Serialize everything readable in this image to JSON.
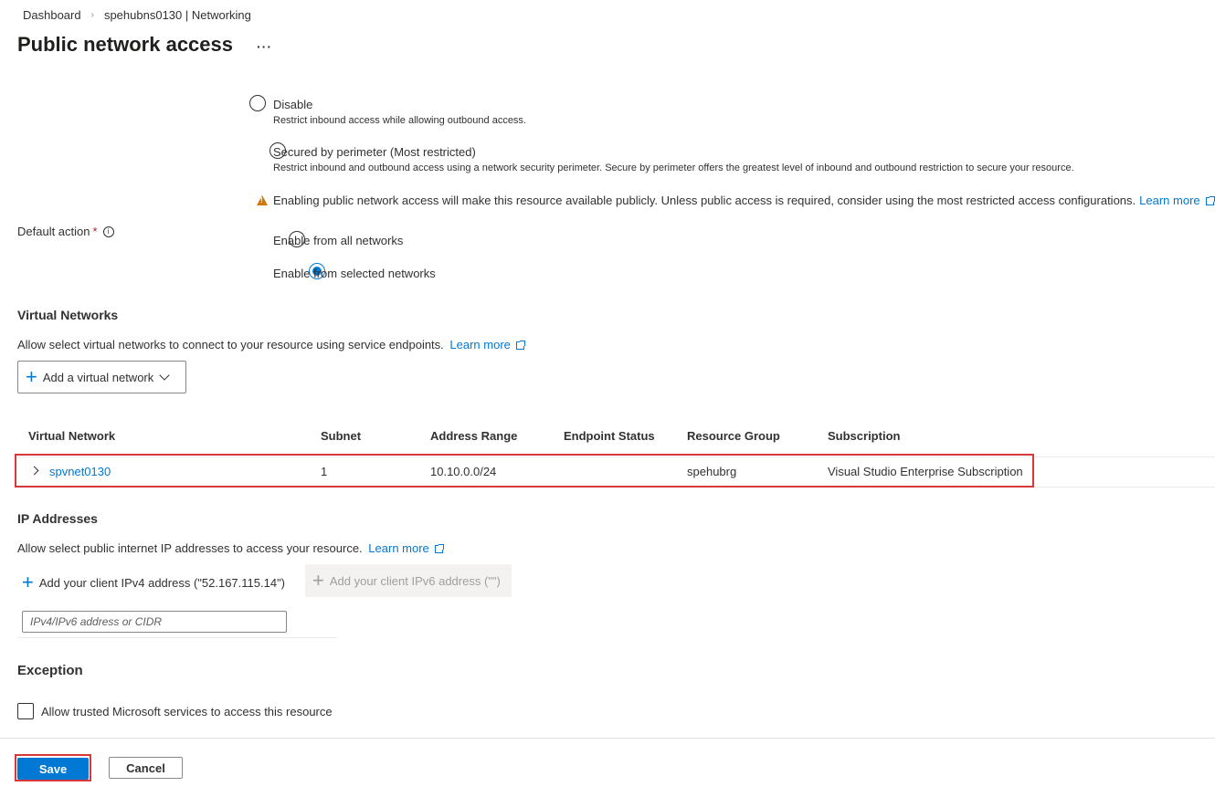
{
  "breadcrumb": {
    "items": [
      "Dashboard",
      "spehubns0130 | Networking"
    ]
  },
  "page": {
    "title": "Public network access",
    "more": "···"
  },
  "access_options": [
    {
      "label": "Disable",
      "description": "Restrict inbound access while allowing outbound access."
    },
    {
      "label": "Secured by perimeter (Most restricted)",
      "description": "Restrict inbound and outbound access using a network security perimeter. Secure by perimeter offers the greatest level of inbound and outbound restriction to secure your resource."
    }
  ],
  "warning": {
    "text": "Enabling public network access will make this resource available publicly. Unless public access is required, consider using the most restricted access configurations.",
    "link": "Learn more"
  },
  "default_action": {
    "label": "Default action",
    "required": "*",
    "options": [
      {
        "label": "Enable from all networks",
        "selected": false
      },
      {
        "label": "Enable from selected networks",
        "selected": true
      }
    ]
  },
  "virtual_networks": {
    "title": "Virtual Networks",
    "description": "Allow select virtual networks to connect to your resource using service endpoints.",
    "link": "Learn more",
    "add_button": "Add a virtual network",
    "columns": [
      "Virtual Network",
      "Subnet",
      "Address Range",
      "Endpoint Status",
      "Resource Group",
      "Subscription"
    ],
    "rows": [
      {
        "name": "spvnet0130",
        "subnet": "1",
        "address_range": "10.10.0.0/24",
        "endpoint_status": "",
        "resource_group": "spehubrg",
        "subscription": "Visual Studio Enterprise Subscription"
      }
    ]
  },
  "ip_addresses": {
    "title": "IP Addresses",
    "description": "Allow select public internet IP addresses to access your resource.",
    "link": "Learn more",
    "add_ipv4": "Add your client IPv4 address (\"52.167.115.14\")",
    "add_ipv6": "Add your client IPv6 address (\"\")",
    "input_placeholder": "IPv4/IPv6 address or CIDR"
  },
  "exception": {
    "title": "Exception",
    "checkbox_label": "Allow trusted Microsoft services to access this resource",
    "checked": false
  },
  "footer": {
    "save": "Save",
    "cancel": "Cancel"
  },
  "colors": {
    "accent": "#0078d4",
    "highlight": "#d9383b",
    "warning": "#d47500"
  }
}
